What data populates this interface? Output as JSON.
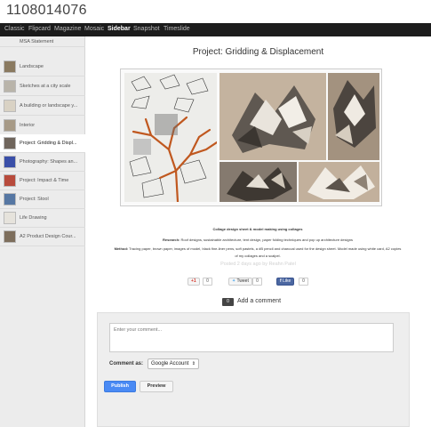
{
  "blog": {
    "title": "1108014076"
  },
  "nav": {
    "items": [
      {
        "label": "Classic",
        "active": false
      },
      {
        "label": "Flipcard",
        "active": false
      },
      {
        "label": "Magazine",
        "active": false
      },
      {
        "label": "Mosaic",
        "active": false
      },
      {
        "label": "Sidebar",
        "active": true
      },
      {
        "label": "Snapshot",
        "active": false
      },
      {
        "label": "Timeslide",
        "active": false
      }
    ]
  },
  "sidebar": {
    "items": [
      {
        "label": "MSA Statement"
      },
      {
        "label": "Landscape"
      },
      {
        "label": "Sketches at a city scale"
      },
      {
        "label": "A building or landscape y..."
      },
      {
        "label": "Interior"
      },
      {
        "label": "Project: Gridding & Displ..."
      },
      {
        "label": "Photography: Shapes an..."
      },
      {
        "label": "Project: Impact & Time"
      },
      {
        "label": "Project: Stool"
      },
      {
        "label": "Life Drawing"
      },
      {
        "label": "A2 Product Design Cour..."
      }
    ]
  },
  "post": {
    "title": "Project: Gridding & Displacement",
    "caption_title": "Collage design sheet & model making using collages",
    "research_label": "Research:",
    "research_text": " Roof designs, sustainable architecture, tent design, paper folding techniques and pop up architecture designs",
    "method_label": "Method:",
    "method_text": " Tracing paper, brown paper, images of model, black fine-liner pens, soft pastels, a #B pencil and charcoal used for the design sheet. Model made using white card, A2 copies",
    "method_text_2": "of my collages and a scalpel.",
    "posted": "Posted 2 days ago by Reahn Patel"
  },
  "share": {
    "gplus_label": "+1",
    "gplus_count": "0",
    "tweet_label": "Tweet",
    "tweet_count": "0",
    "fb_label": "Like",
    "fb_count": "0"
  },
  "comments": {
    "count": "0",
    "heading": "Add a comment",
    "placeholder": "Enter your comment...",
    "comment_as_label": "Comment as:",
    "comment_as_value": "Google Account",
    "publish_label": "Publish",
    "preview_label": "Preview"
  },
  "colors": {
    "navbar_bg": "#1c1c1c",
    "sidebar_bg": "#ececec",
    "publish_blue": "#4a8af4",
    "facebook_blue": "#4b67a1"
  }
}
